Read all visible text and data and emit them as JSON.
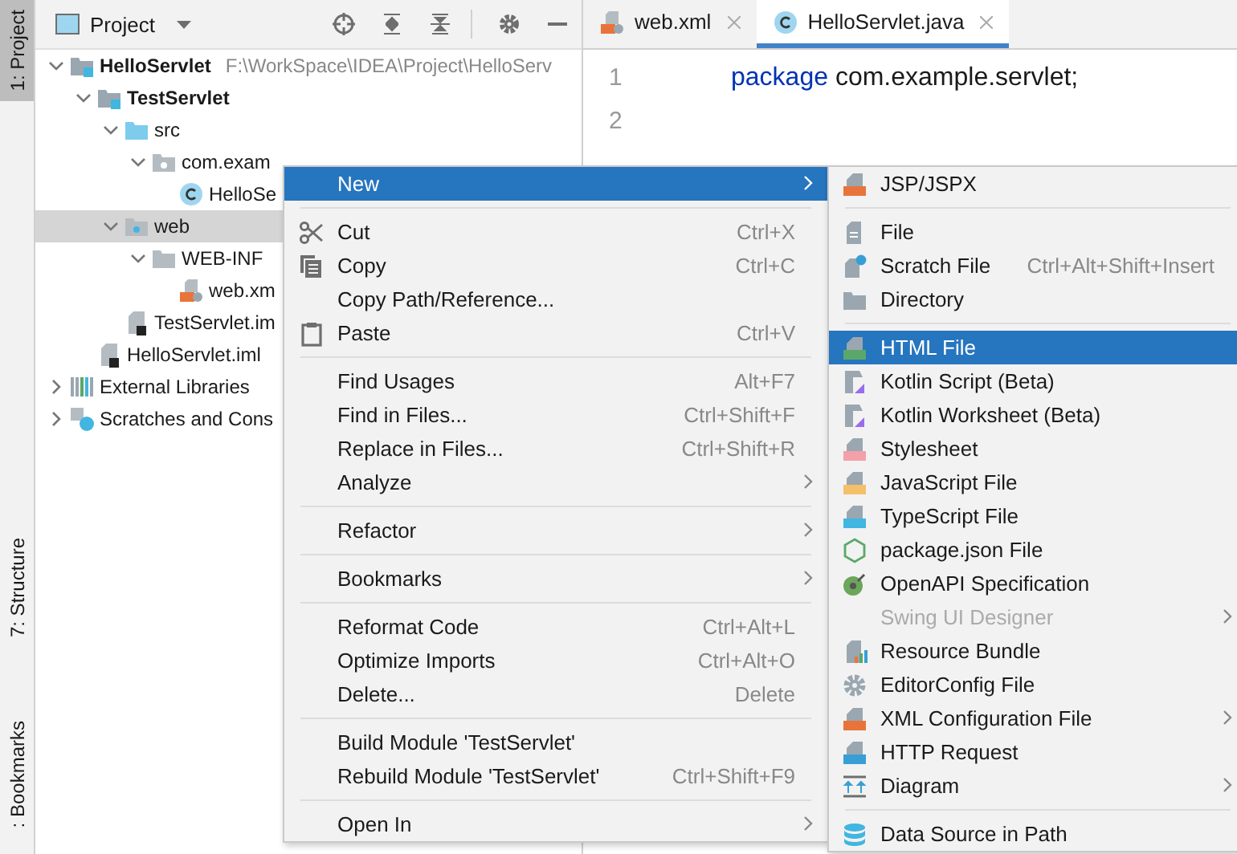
{
  "left_stripe": [
    {
      "label": "1: Project",
      "selected": true
    },
    {
      "label": "7: Structure",
      "selected": false
    },
    {
      "label": ": Bookmarks",
      "selected": false
    }
  ],
  "project": {
    "title": "Project",
    "tree": [
      {
        "label": "HelloServlet",
        "bold": true,
        "path": "F:\\WorkSpace\\IDEA\\Project\\HelloServ",
        "kind": "module",
        "expanded": true,
        "selected": false,
        "children": [
          {
            "label": "TestServlet",
            "bold": true,
            "kind": "module",
            "expanded": true,
            "selected": false,
            "children": [
              {
                "label": "src",
                "kind": "source",
                "expanded": true,
                "selected": false,
                "children": [
                  {
                    "label": "com.exam",
                    "kind": "package",
                    "expanded": true,
                    "selected": false,
                    "children": [
                      {
                        "label": "HelloSe",
                        "kind": "class",
                        "selected": false
                      }
                    ]
                  }
                ]
              },
              {
                "label": "web",
                "kind": "web",
                "expanded": true,
                "selected": true,
                "children": [
                  {
                    "label": "WEB-INF",
                    "kind": "folder",
                    "expanded": true,
                    "selected": false,
                    "children": [
                      {
                        "label": "web.xm",
                        "kind": "xml",
                        "selected": false
                      }
                    ]
                  }
                ]
              },
              {
                "label": "TestServlet.im",
                "kind": "iml",
                "selected": false
              }
            ]
          },
          {
            "label": "HelloServlet.iml",
            "kind": "iml",
            "selected": false
          }
        ]
      },
      {
        "label": "External Libraries",
        "kind": "library",
        "expanded": false,
        "selected": false
      },
      {
        "label": "Scratches and Cons",
        "kind": "scratch",
        "expanded": false,
        "selected": false
      }
    ]
  },
  "editor": {
    "tabs": [
      {
        "label": "web.xml",
        "kind": "xml",
        "selected": false
      },
      {
        "label": "HelloServlet.java",
        "kind": "class",
        "selected": true
      }
    ],
    "lines": [
      {
        "number": "1",
        "keyword": "package",
        "text": " com.example.servlet;"
      },
      {
        "number": "2"
      }
    ]
  },
  "context_menu": [
    {
      "kind": "item",
      "label": "New",
      "selected": true,
      "submenu": true
    },
    {
      "kind": "separator"
    },
    {
      "kind": "item",
      "label": "Cut",
      "shortcut": "Ctrl+X",
      "selected": false,
      "submenu": false
    },
    {
      "kind": "item",
      "label": "Copy",
      "shortcut": "Ctrl+C",
      "selected": false,
      "submenu": false
    },
    {
      "kind": "item",
      "label": "Copy Path/Reference...",
      "selected": false,
      "submenu": false
    },
    {
      "kind": "item",
      "label": "Paste",
      "shortcut": "Ctrl+V",
      "selected": false,
      "submenu": false
    },
    {
      "kind": "separator"
    },
    {
      "kind": "item",
      "label": "Find Usages",
      "shortcut": "Alt+F7",
      "selected": false,
      "submenu": false
    },
    {
      "kind": "item",
      "label": "Find in Files...",
      "shortcut": "Ctrl+Shift+F",
      "selected": false,
      "submenu": false
    },
    {
      "kind": "item",
      "label": "Replace in Files...",
      "shortcut": "Ctrl+Shift+R",
      "selected": false,
      "submenu": false
    },
    {
      "kind": "item",
      "label": "Analyze",
      "selected": false,
      "submenu": true
    },
    {
      "kind": "separator"
    },
    {
      "kind": "item",
      "label": "Refactor",
      "selected": false,
      "submenu": true
    },
    {
      "kind": "separator"
    },
    {
      "kind": "item",
      "label": "Bookmarks",
      "selected": false,
      "submenu": true
    },
    {
      "kind": "separator"
    },
    {
      "kind": "item",
      "label": "Reformat Code",
      "shortcut": "Ctrl+Alt+L",
      "selected": false,
      "submenu": false
    },
    {
      "kind": "item",
      "label": "Optimize Imports",
      "shortcut": "Ctrl+Alt+O",
      "selected": false,
      "submenu": false
    },
    {
      "kind": "item",
      "label": "Delete...",
      "shortcut": "Delete",
      "selected": false,
      "submenu": false
    },
    {
      "kind": "separator"
    },
    {
      "kind": "item",
      "label": "Build Module 'TestServlet'",
      "selected": false,
      "submenu": false
    },
    {
      "kind": "item",
      "label": "Rebuild Module 'TestServlet'",
      "shortcut": "Ctrl+Shift+F9",
      "selected": false,
      "submenu": false
    },
    {
      "kind": "separator"
    },
    {
      "kind": "item",
      "label": "Open In",
      "selected": false,
      "submenu": true
    }
  ],
  "new_submenu": [
    {
      "kind": "item",
      "label": "JSP/JSPX",
      "selected": false,
      "disabled": false,
      "submenu": false
    },
    {
      "kind": "separator"
    },
    {
      "kind": "item",
      "label": "File",
      "selected": false,
      "disabled": false,
      "submenu": false
    },
    {
      "kind": "item",
      "label": "Scratch File",
      "shortcut": "Ctrl+Alt+Shift+Insert",
      "selected": false,
      "disabled": false,
      "submenu": false
    },
    {
      "kind": "item",
      "label": "Directory",
      "selected": false,
      "disabled": false,
      "submenu": false
    },
    {
      "kind": "separator"
    },
    {
      "kind": "item",
      "label": "HTML File",
      "selected": true,
      "disabled": false,
      "submenu": false
    },
    {
      "kind": "item",
      "label": "Kotlin Script (Beta)",
      "selected": false,
      "disabled": false,
      "submenu": false
    },
    {
      "kind": "item",
      "label": "Kotlin Worksheet (Beta)",
      "selected": false,
      "disabled": false,
      "submenu": false
    },
    {
      "kind": "item",
      "label": "Stylesheet",
      "selected": false,
      "disabled": false,
      "submenu": false
    },
    {
      "kind": "item",
      "label": "JavaScript File",
      "selected": false,
      "disabled": false,
      "submenu": false
    },
    {
      "kind": "item",
      "label": "TypeScript File",
      "selected": false,
      "disabled": false,
      "submenu": false
    },
    {
      "kind": "item",
      "label": "package.json File",
      "selected": false,
      "disabled": false,
      "submenu": false
    },
    {
      "kind": "item",
      "label": "OpenAPI Specification",
      "selected": false,
      "disabled": false,
      "submenu": false
    },
    {
      "kind": "item",
      "label": "Swing UI Designer",
      "selected": false,
      "disabled": true,
      "submenu": true
    },
    {
      "kind": "item",
      "label": "Resource Bundle",
      "selected": false,
      "disabled": false,
      "submenu": false
    },
    {
      "kind": "item",
      "label": "EditorConfig File",
      "selected": false,
      "disabled": false,
      "submenu": false
    },
    {
      "kind": "item",
      "label": "XML Configuration File",
      "selected": false,
      "disabled": false,
      "submenu": true
    },
    {
      "kind": "item",
      "label": "HTTP Request",
      "selected": false,
      "disabled": false,
      "submenu": false
    },
    {
      "kind": "item",
      "label": "Diagram",
      "selected": false,
      "disabled": false,
      "submenu": true
    },
    {
      "kind": "separator"
    },
    {
      "kind": "item",
      "label": "Data Source in Path",
      "selected": false,
      "disabled": false,
      "submenu": false
    }
  ]
}
